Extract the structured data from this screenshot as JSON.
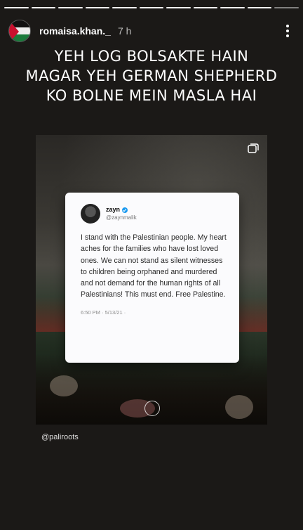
{
  "story": {
    "segments_total": 11,
    "segments_done": 10
  },
  "header": {
    "avatar_icon": "palestine-flag-avatar",
    "username": "romaisa.khan._",
    "time": "7 h",
    "more_icon": "vertical-ellipsis-icon"
  },
  "caption": {
    "lines": [
      "YEH LOG BOLSAKTE HAIN",
      "MAGAR YEH GERMAN SHEPHERD",
      "KO BOLNE MEIN MASLA HAI"
    ]
  },
  "tweet": {
    "name": "zayn",
    "handle": "@zaynmalik",
    "body": "I stand with the Palestinian people. My heart aches for the families who have lost loved ones. We can not stand as silent witnesses to children being orphaned and murdered and not demand for the human rights of all Palestinians!  This must end. Free Palestine.",
    "meta": "6:50 PM · 5/13/21 ·"
  },
  "credit": "@paliroots",
  "colors": {
    "background": "#1b1917",
    "verified": "#1d9bf0"
  }
}
